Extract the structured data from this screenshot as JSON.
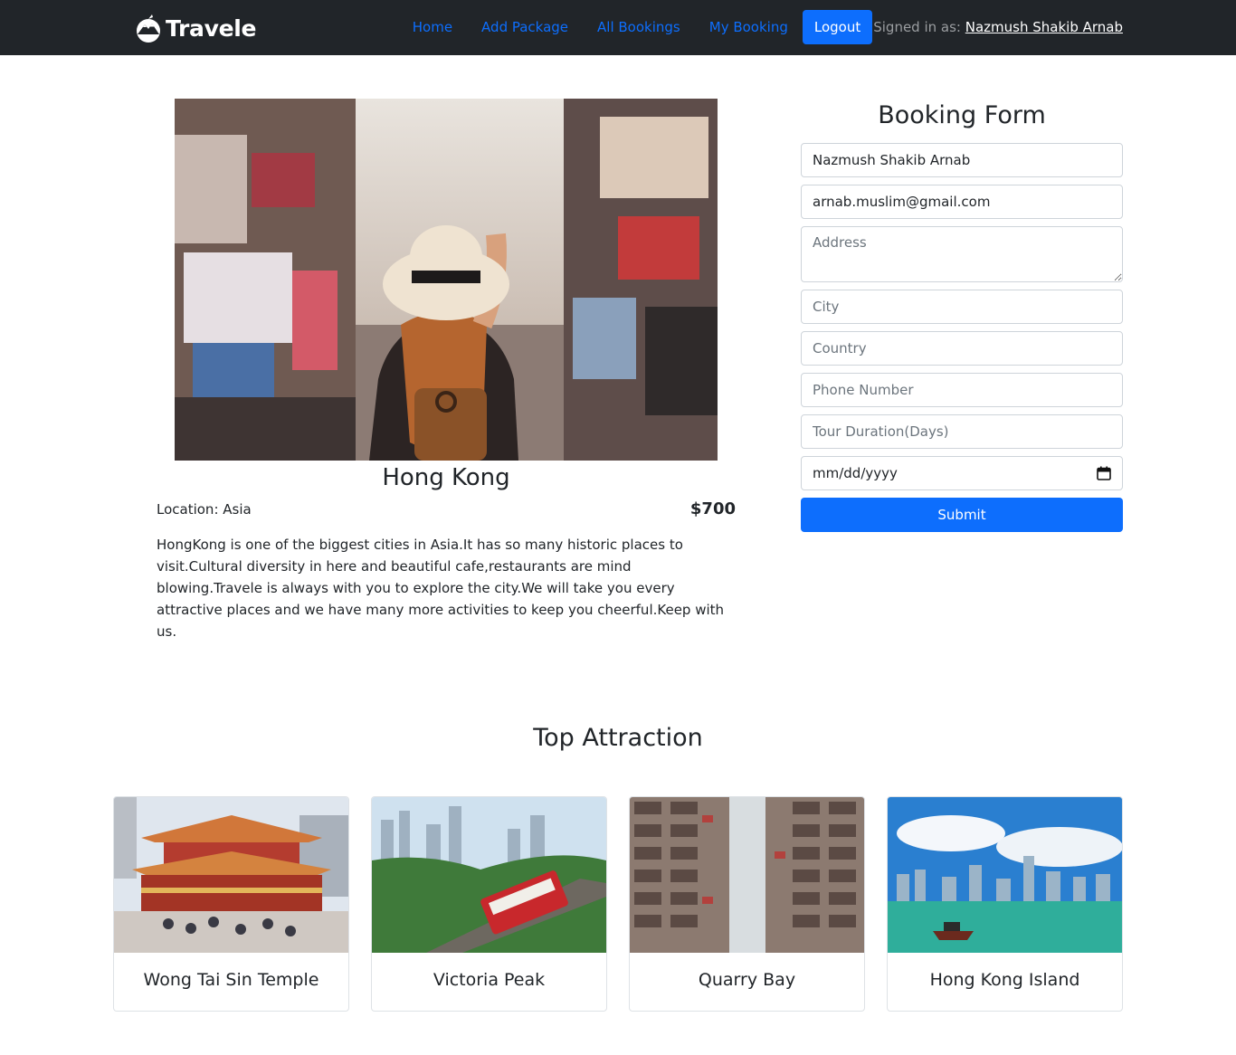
{
  "navbar": {
    "brand": "Travele",
    "links": [
      "Home",
      "Add Package",
      "All Bookings",
      "My Booking"
    ],
    "logout_label": "Logout",
    "signed_in_prefix": "Signed in as: ",
    "user_name": "Nazmush Shakib Arnab"
  },
  "package": {
    "title": "Hong Kong",
    "location": "Location: Asia",
    "price": "$700",
    "description": "HongKong is one of the biggest cities in Asia.It has so many historic places to visit.Cultural diversity in here and beautiful cafe,restaurants are mind blowing.Travele is always with you to explore the city.We will take you every attractive places and we have many more activities to keep you cheerful.Keep with us.",
    "image_icon": "traveler-street-photo"
  },
  "booking_form": {
    "title": "Booking Form",
    "name_value": "Nazmush Shakib Arnab",
    "email_value": "arnab.muslim@gmail.com",
    "address_placeholder": "Address",
    "city_placeholder": "City",
    "country_placeholder": "Country",
    "phone_placeholder": "Phone Number",
    "duration_placeholder": "Tour Duration(Days)",
    "date_placeholder": "mm/dd/yyyy",
    "submit_label": "Submit"
  },
  "attractions": {
    "title": "Top Attraction",
    "items": [
      {
        "name": "Wong Tai Sin Temple",
        "image_icon": "temple-photo"
      },
      {
        "name": "Victoria Peak",
        "image_icon": "peak-tram-photo"
      },
      {
        "name": "Quarry Bay",
        "image_icon": "apartment-blocks-photo"
      },
      {
        "name": "Hong Kong Island",
        "image_icon": "harbour-skyline-photo"
      }
    ]
  },
  "colors": {
    "navbar_bg": "#212529",
    "accent": "#0d6efd"
  }
}
